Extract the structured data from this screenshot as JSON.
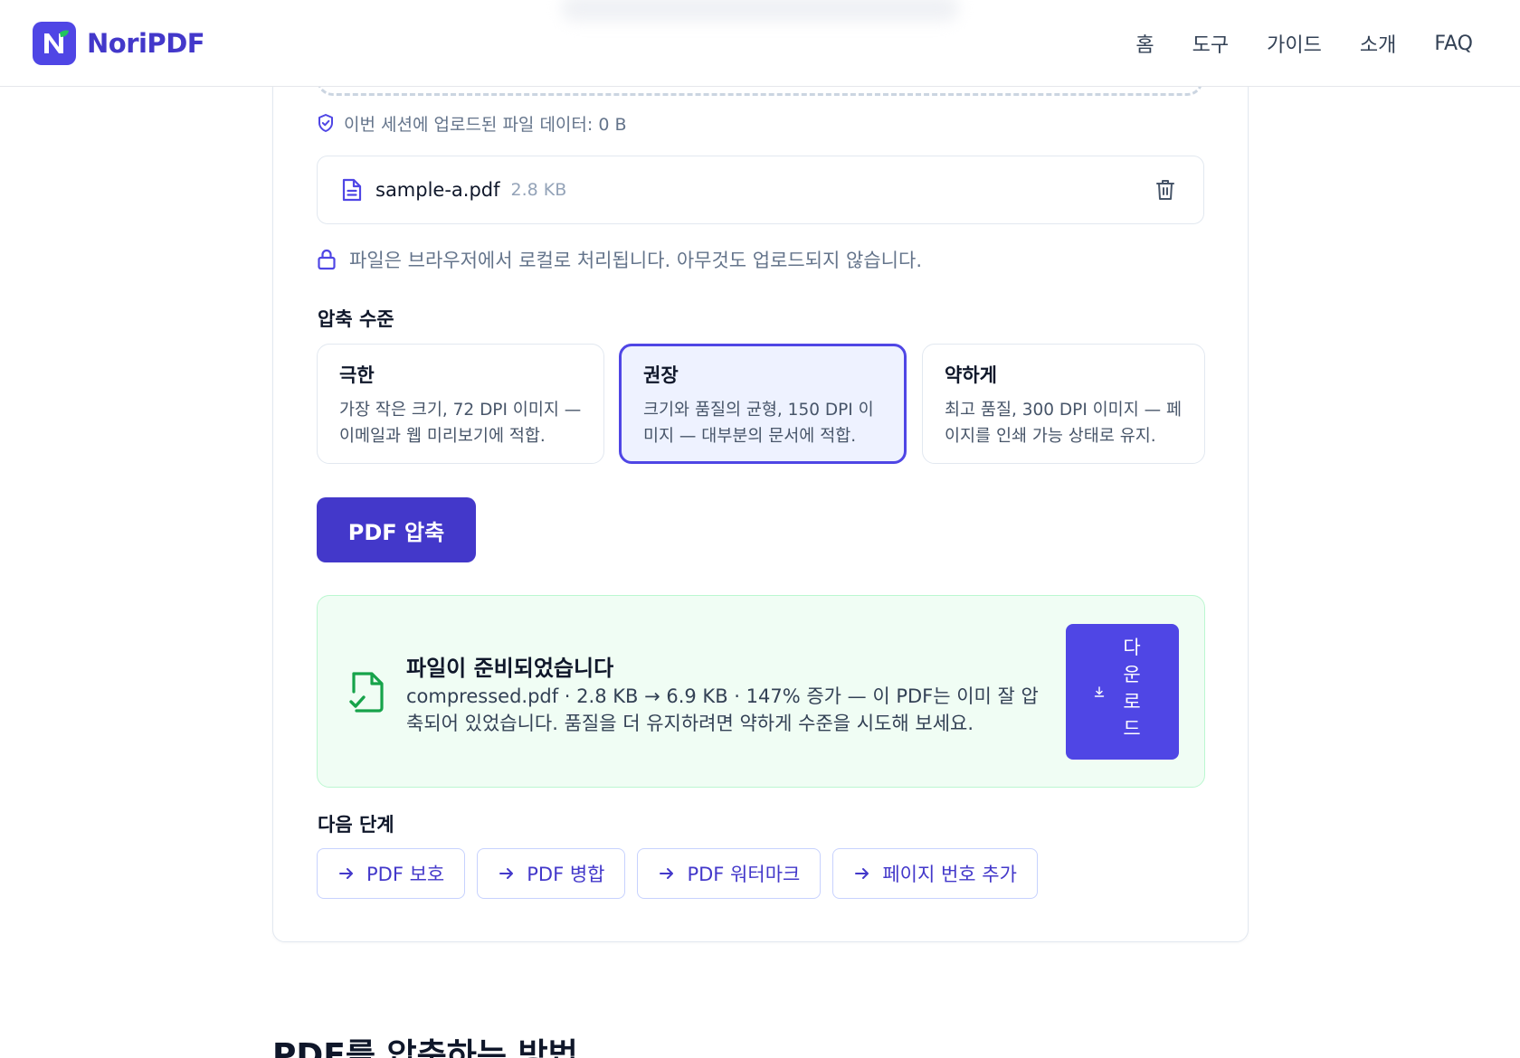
{
  "header": {
    "brand": "NoriPDF",
    "nav": [
      "홈",
      "도구",
      "가이드",
      "소개",
      "FAQ"
    ]
  },
  "session_note": "이번 세션에 업로드된 파일 데이터: 0 B",
  "file": {
    "name": "sample-a.pdf",
    "size": "2.8 KB"
  },
  "local_note": "파일은 브라우저에서 로컬로 처리됩니다. 아무것도 업로드되지 않습니다.",
  "compression": {
    "label": "압축 수준",
    "levels": [
      {
        "title": "극한",
        "desc": "가장 작은 크기, 72 DPI 이미지 — 이메일과 웹 미리보기에 적합.",
        "selected": false
      },
      {
        "title": "권장",
        "desc": "크기와 품질의 균형, 150 DPI 이미지 — 대부분의 문서에 적합.",
        "selected": true
      },
      {
        "title": "약하게",
        "desc": "최고 품질, 300 DPI 이미지 — 페이지를 인쇄 가능 상태로 유지.",
        "selected": false
      }
    ]
  },
  "compress_button": "PDF 압축",
  "result": {
    "title": "파일이 준비되었습니다",
    "desc": "compressed.pdf · 2.8 KB → 6.9 KB · 147% 증가 — 이 PDF는 이미 잘 압축되어 있었습니다. 품질을 더 유지하려면 약하게 수준을 시도해 보세요.",
    "download": "다운로드"
  },
  "next": {
    "label": "다음 단계",
    "items": [
      "PDF 보호",
      "PDF 병합",
      "PDF 워터마크",
      "페이지 번호 추가"
    ]
  },
  "howto_heading": "PDF를 압축하는 방법",
  "colors": {
    "accent": "#4f46e5",
    "accent_dark": "#4338ca",
    "success_bg": "#f0fdf4",
    "success_icon": "#16a34a"
  }
}
